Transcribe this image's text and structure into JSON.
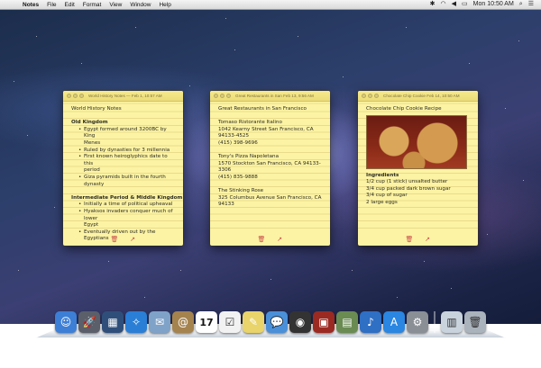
{
  "menubar": {
    "app": "Notes",
    "items": [
      "File",
      "Edit",
      "Format",
      "View",
      "Window",
      "Help"
    ],
    "clock": "Mon 10:50 AM"
  },
  "notes": [
    {
      "title_bar": "World History Notes — Feb 1, 10:57 AM",
      "lines": [
        {
          "type": "text",
          "text": "World History Notes"
        },
        {
          "type": "gap"
        },
        {
          "type": "heading",
          "text": "Old Kingdom"
        },
        {
          "type": "bullet",
          "text": "Egypt formed around 3200BC by King"
        },
        {
          "type": "cont",
          "text": "Menes"
        },
        {
          "type": "bullet",
          "text": "Ruled by dynasties for 3 millennia"
        },
        {
          "type": "bullet",
          "text": "First known heiroglyphics date to this"
        },
        {
          "type": "cont",
          "text": "period"
        },
        {
          "type": "bullet",
          "text": "Giza pyramids built in the fourth dynasty"
        },
        {
          "type": "gap"
        },
        {
          "type": "heading",
          "text": "Intermediate Period & Middle Kingdom"
        },
        {
          "type": "bullet",
          "text": "Initially a time of political upheaval"
        },
        {
          "type": "bullet",
          "text": "Hyaksos invaders conquer much of lower"
        },
        {
          "type": "cont",
          "text": "Egypt"
        },
        {
          "type": "bullet",
          "text": "Eventually driven out by the Egyptians"
        }
      ]
    },
    {
      "title_bar": "Great Restaurants in San Feb 13, 9:56 AM",
      "lines": [
        {
          "type": "text",
          "text": "Great Restaurants in San Francisco"
        },
        {
          "type": "gap"
        },
        {
          "type": "text",
          "text": "Tomaso Ristorante Italino"
        },
        {
          "type": "text",
          "text": "1042 Kearny Street San Francisco, CA"
        },
        {
          "type": "text",
          "text": "94133-4525"
        },
        {
          "type": "text",
          "text": "(415) 398-9696"
        },
        {
          "type": "gap"
        },
        {
          "type": "text",
          "text": "Tony's Pizza Napoletana"
        },
        {
          "type": "text",
          "text": "1570 Stockton San Francisco, CA 94133-"
        },
        {
          "type": "text",
          "text": "3306"
        },
        {
          "type": "text",
          "text": "(415) 835-9888"
        },
        {
          "type": "gap"
        },
        {
          "type": "text",
          "text": "The Stinking Rose"
        },
        {
          "type": "text",
          "text": "325 Columbus Avenue San Francisco, CA"
        },
        {
          "type": "text",
          "text": "94133"
        }
      ]
    },
    {
      "title_bar": "Chocolate Chip Cookie Feb 14, 10:50 AM",
      "lines": [
        {
          "type": "text",
          "text": "Chocolate Chip Cookie Recipe"
        },
        {
          "type": "photo"
        },
        {
          "type": "heading",
          "text": "Ingredients"
        },
        {
          "type": "text",
          "text": "1/2 cup (1 stick) unsalted butter"
        },
        {
          "type": "text",
          "text": "3/4 cup packed dark brown sugar"
        },
        {
          "type": "text",
          "text": "3/4 cup of sugar"
        },
        {
          "type": "text",
          "text": "2 large eggs"
        }
      ]
    }
  ],
  "dock": {
    "icons": [
      {
        "name": "finder",
        "glyph": "☺",
        "color": "#3d7fd6"
      },
      {
        "name": "launchpad",
        "glyph": "🚀",
        "color": "#5a5f6a"
      },
      {
        "name": "mission-control",
        "glyph": "▦",
        "color": "#2f4f7a"
      },
      {
        "name": "safari",
        "glyph": "✧",
        "color": "#2a7ed6"
      },
      {
        "name": "mail",
        "glyph": "✉",
        "color": "#7fa2c8"
      },
      {
        "name": "contacts",
        "glyph": "@",
        "color": "#a5834e"
      },
      {
        "name": "calendar",
        "glyph": "17",
        "color": "#ffffff"
      },
      {
        "name": "reminders",
        "glyph": "☑",
        "color": "#f2f2f2"
      },
      {
        "name": "notes",
        "glyph": "✎",
        "color": "#e8d46a"
      },
      {
        "name": "messages",
        "glyph": "💬",
        "color": "#4a90d9"
      },
      {
        "name": "facetime",
        "glyph": "◉",
        "color": "#333333"
      },
      {
        "name": "photo-booth",
        "glyph": "▣",
        "color": "#9b2a22"
      },
      {
        "name": "iphoto",
        "glyph": "▤",
        "color": "#6a8b52"
      },
      {
        "name": "itunes",
        "glyph": "♪",
        "color": "#2f6fc4"
      },
      {
        "name": "app-store",
        "glyph": "A",
        "color": "#2a86e0"
      },
      {
        "name": "system-preferences",
        "glyph": "⚙",
        "color": "#8a8f96"
      }
    ],
    "right_icons": [
      {
        "name": "documents-stack",
        "glyph": "▥",
        "color": "#c9d3dd"
      },
      {
        "name": "trash",
        "glyph": "🗑",
        "color": "#aab2bb"
      }
    ]
  }
}
